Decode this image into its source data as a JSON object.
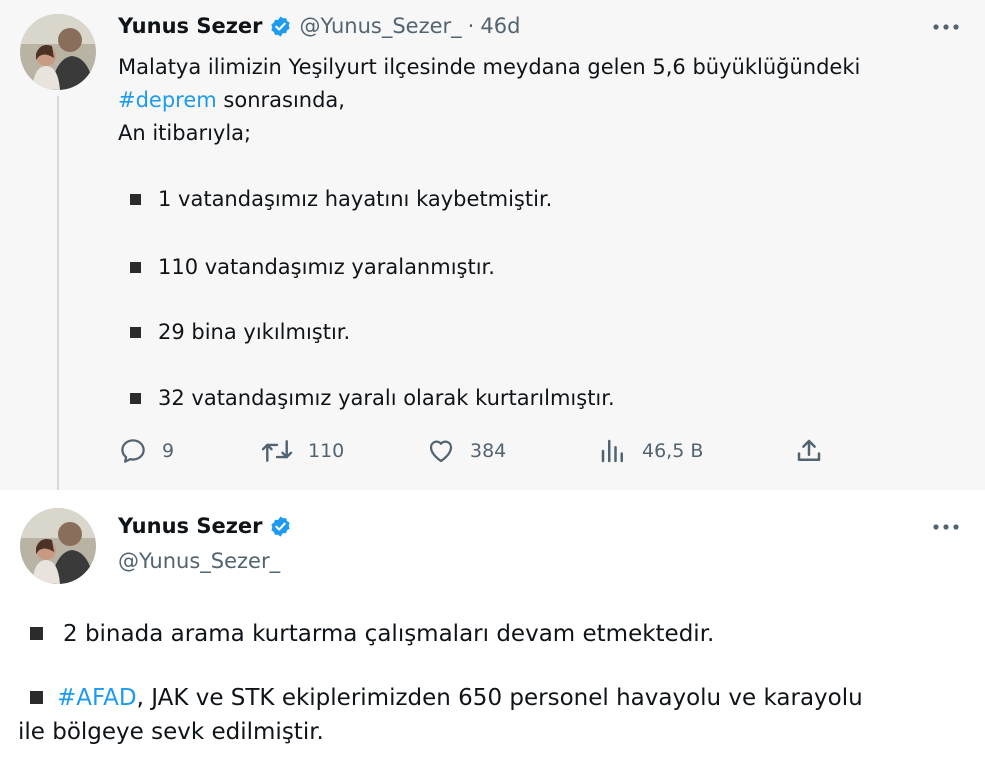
{
  "tweet1": {
    "display_name": "Yunus Sezer",
    "handle": "@Yunus_Sezer_",
    "separator": "·",
    "time": "46d",
    "text_line1": "Malatya ilimizin Yeşilyurt ilçesinde meydana gelen 5,6 büyüklüğündeki",
    "hashtag": "#deprem",
    "text_line2_rest": " sonrasında,",
    "text_line3": "An itibarıyla;",
    "bullets": [
      "1 vatandaşımız hayatını kaybetmiştir.",
      "110 vatandaşımız yaralanmıştır.",
      "29 bina yıkılmıştır.",
      "32 vatandaşımız yaralı olarak kurtarılmıştır."
    ],
    "actions": {
      "replies": "9",
      "retweets": "110",
      "likes": "384",
      "views": "46,5 B"
    }
  },
  "tweet2": {
    "display_name": "Yunus Sezer",
    "handle": "@Yunus_Sezer_",
    "line1": "2 binada arama kurtarma çalışmaları devam etmektedir.",
    "hashtag": "#AFAD",
    "line2_rest": ", JAK ve STK ekiplerimizden 650 personel havayolu ve karayolu",
    "line3": "ile bölgeye sevk edilmiştir."
  },
  "colors": {
    "accent": "#1d9bf0",
    "muted": "#536471",
    "text": "#0f1419",
    "thread_bg": "#f7f7f7"
  },
  "icons": {
    "verified": "verified-badge-icon",
    "more": "more-horizontal-icon",
    "reply": "reply-icon",
    "retweet": "retweet-icon",
    "like": "heart-icon",
    "views": "views-chart-icon",
    "share": "share-icon"
  }
}
